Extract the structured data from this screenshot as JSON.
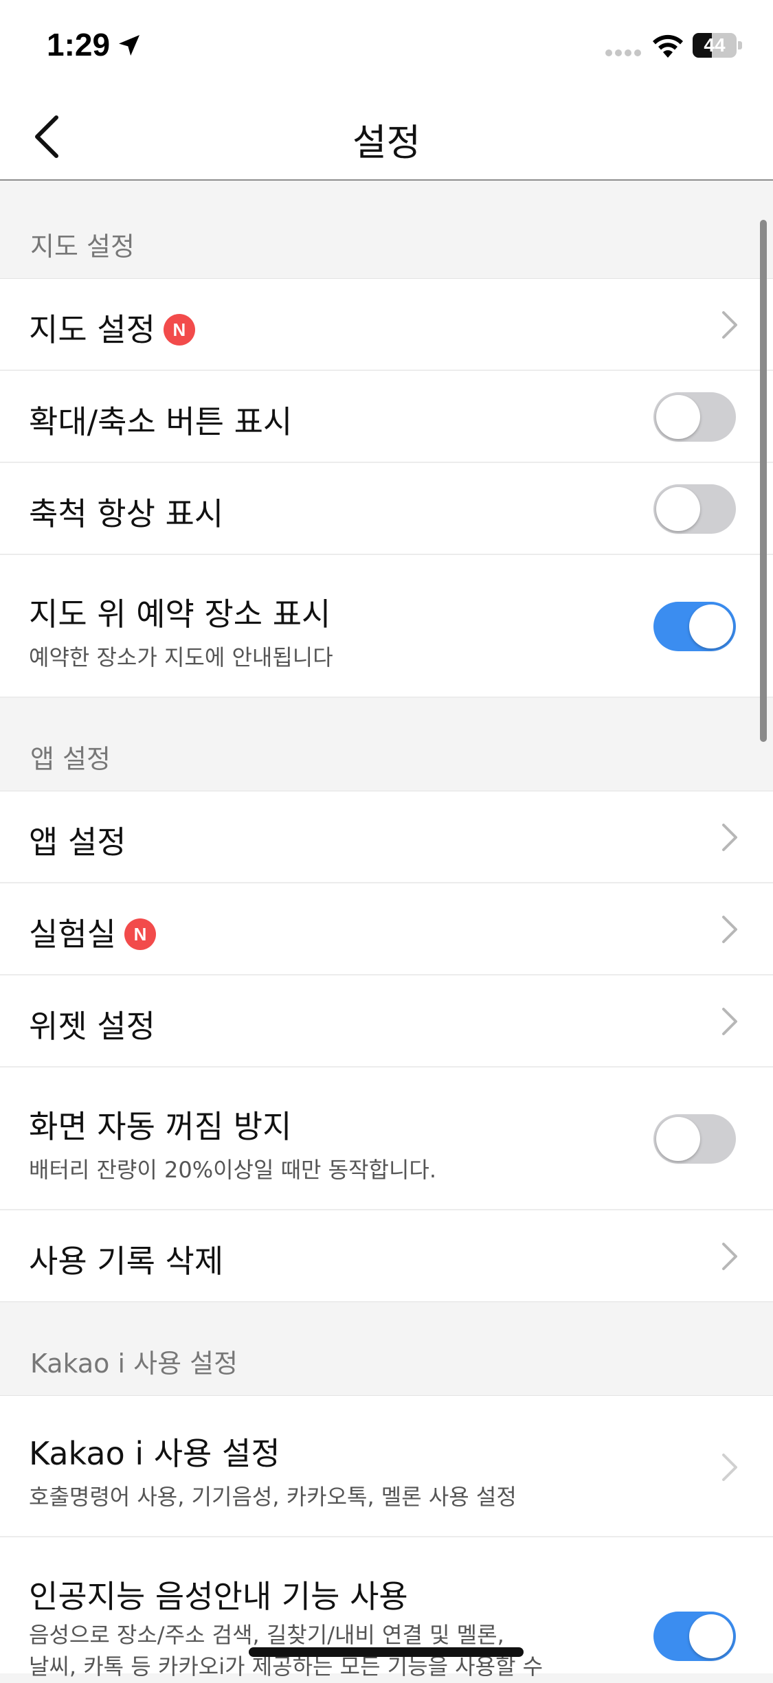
{
  "status_bar": {
    "time": "1:29",
    "battery_level": "44",
    "battery_fraction": 0.44
  },
  "nav": {
    "title": "설정"
  },
  "sections": {
    "map": {
      "header": "지도 설정",
      "items": [
        {
          "label": "지도 설정",
          "badge": "N",
          "control": "chevron"
        },
        {
          "label": "확대/축소 버튼 표시",
          "control": "toggle",
          "on": false
        },
        {
          "label": "축척 항상 표시",
          "control": "toggle",
          "on": false
        },
        {
          "label": "지도 위 예약 장소 표시",
          "sub": "예약한 장소가 지도에 안내됩니다",
          "control": "toggle",
          "on": true
        }
      ]
    },
    "app": {
      "header": "앱 설정",
      "items": [
        {
          "label": "앱 설정",
          "control": "chevron"
        },
        {
          "label": "실험실",
          "badge": "N",
          "control": "chevron"
        },
        {
          "label": "위젯 설정",
          "control": "chevron"
        },
        {
          "label": "화면 자동 꺼짐 방지",
          "sub": "배터리 잔량이 20%이상일 때만 동작합니다.",
          "control": "toggle",
          "on": false
        },
        {
          "label": "사용 기록 삭제",
          "control": "chevron"
        }
      ]
    },
    "kakao": {
      "header": "Kakao i 사용 설정",
      "items": [
        {
          "label": "Kakao i 사용 설정",
          "sub": "호출명령어 사용, 기기음성, 카카오톡, 멜론 사용 설정",
          "control": "chevron"
        },
        {
          "label": "인공지능 음성안내 기능 사용",
          "sub": "음성으로 장소/주소 검색, 길찾기/내비 연결 및 멜론,",
          "sub2": "날씨, 카톡 등 카카오i가 제공하는 모든 기능을 사용할 수",
          "control": "toggle",
          "on": true
        }
      ]
    }
  },
  "icons": {
    "location": "location-arrow-icon",
    "wifi": "wifi-icon",
    "back": "chevron-left-icon",
    "chevron": "chevron-right-icon"
  },
  "colors": {
    "toggle_on": "#3b8df0",
    "toggle_off": "#cfcfd2",
    "badge": "#f24b4b"
  }
}
